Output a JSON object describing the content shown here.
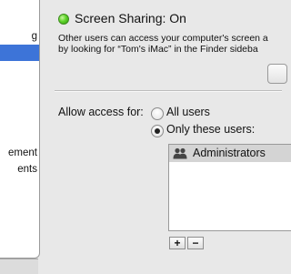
{
  "sidebar": {
    "items": [
      {
        "label": "g",
        "selected": false
      },
      {
        "label": "",
        "selected": true
      },
      {
        "label": "ement",
        "selected": false
      },
      {
        "label": "ents",
        "selected": false
      }
    ]
  },
  "status": {
    "label": "Screen Sharing: On",
    "indicator_color": "#4cc520"
  },
  "description": {
    "line1": "Other users can access your computer's screen a",
    "line2": "by looking for “Tom's iMac” in the Finder sideba"
  },
  "access": {
    "label": "Allow access for:",
    "options": [
      {
        "label": "All users",
        "selected": false
      },
      {
        "label": "Only these users:",
        "selected": true
      }
    ]
  },
  "users_list": {
    "items": [
      {
        "label": "Administrators",
        "icon": "group-icon"
      }
    ]
  },
  "list_buttons": {
    "add": "+",
    "remove": "−"
  },
  "colors": {
    "selection": "#3d74d8",
    "row_highlight": "#d4d4d4",
    "window_bg": "#e8e8e8"
  }
}
